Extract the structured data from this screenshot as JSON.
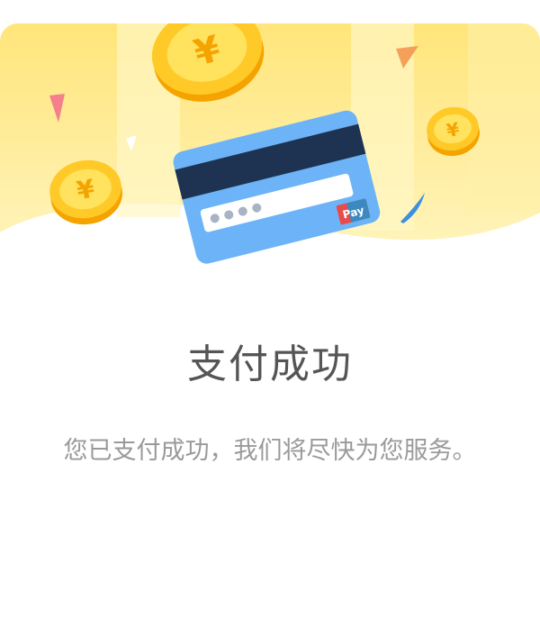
{
  "dialog": {
    "title": "支付成功",
    "message": "您已支付成功，我们将尽快为您服务。"
  },
  "illustration": {
    "card_badge_label": "Pay",
    "coin_symbol": "¥",
    "icons": [
      "coin-icon",
      "bank-card-icon",
      "confetti-icon"
    ]
  },
  "colors": {
    "banner_yellow": "#FFE97A",
    "banner_light": "#FFF6C4",
    "coin_gold": "#FFC107",
    "coin_edge": "#F5A300",
    "card_blue": "#6CB4F7",
    "card_stripe": "#1E3352",
    "title_text": "#555555",
    "message_text": "#9A9A9A"
  }
}
